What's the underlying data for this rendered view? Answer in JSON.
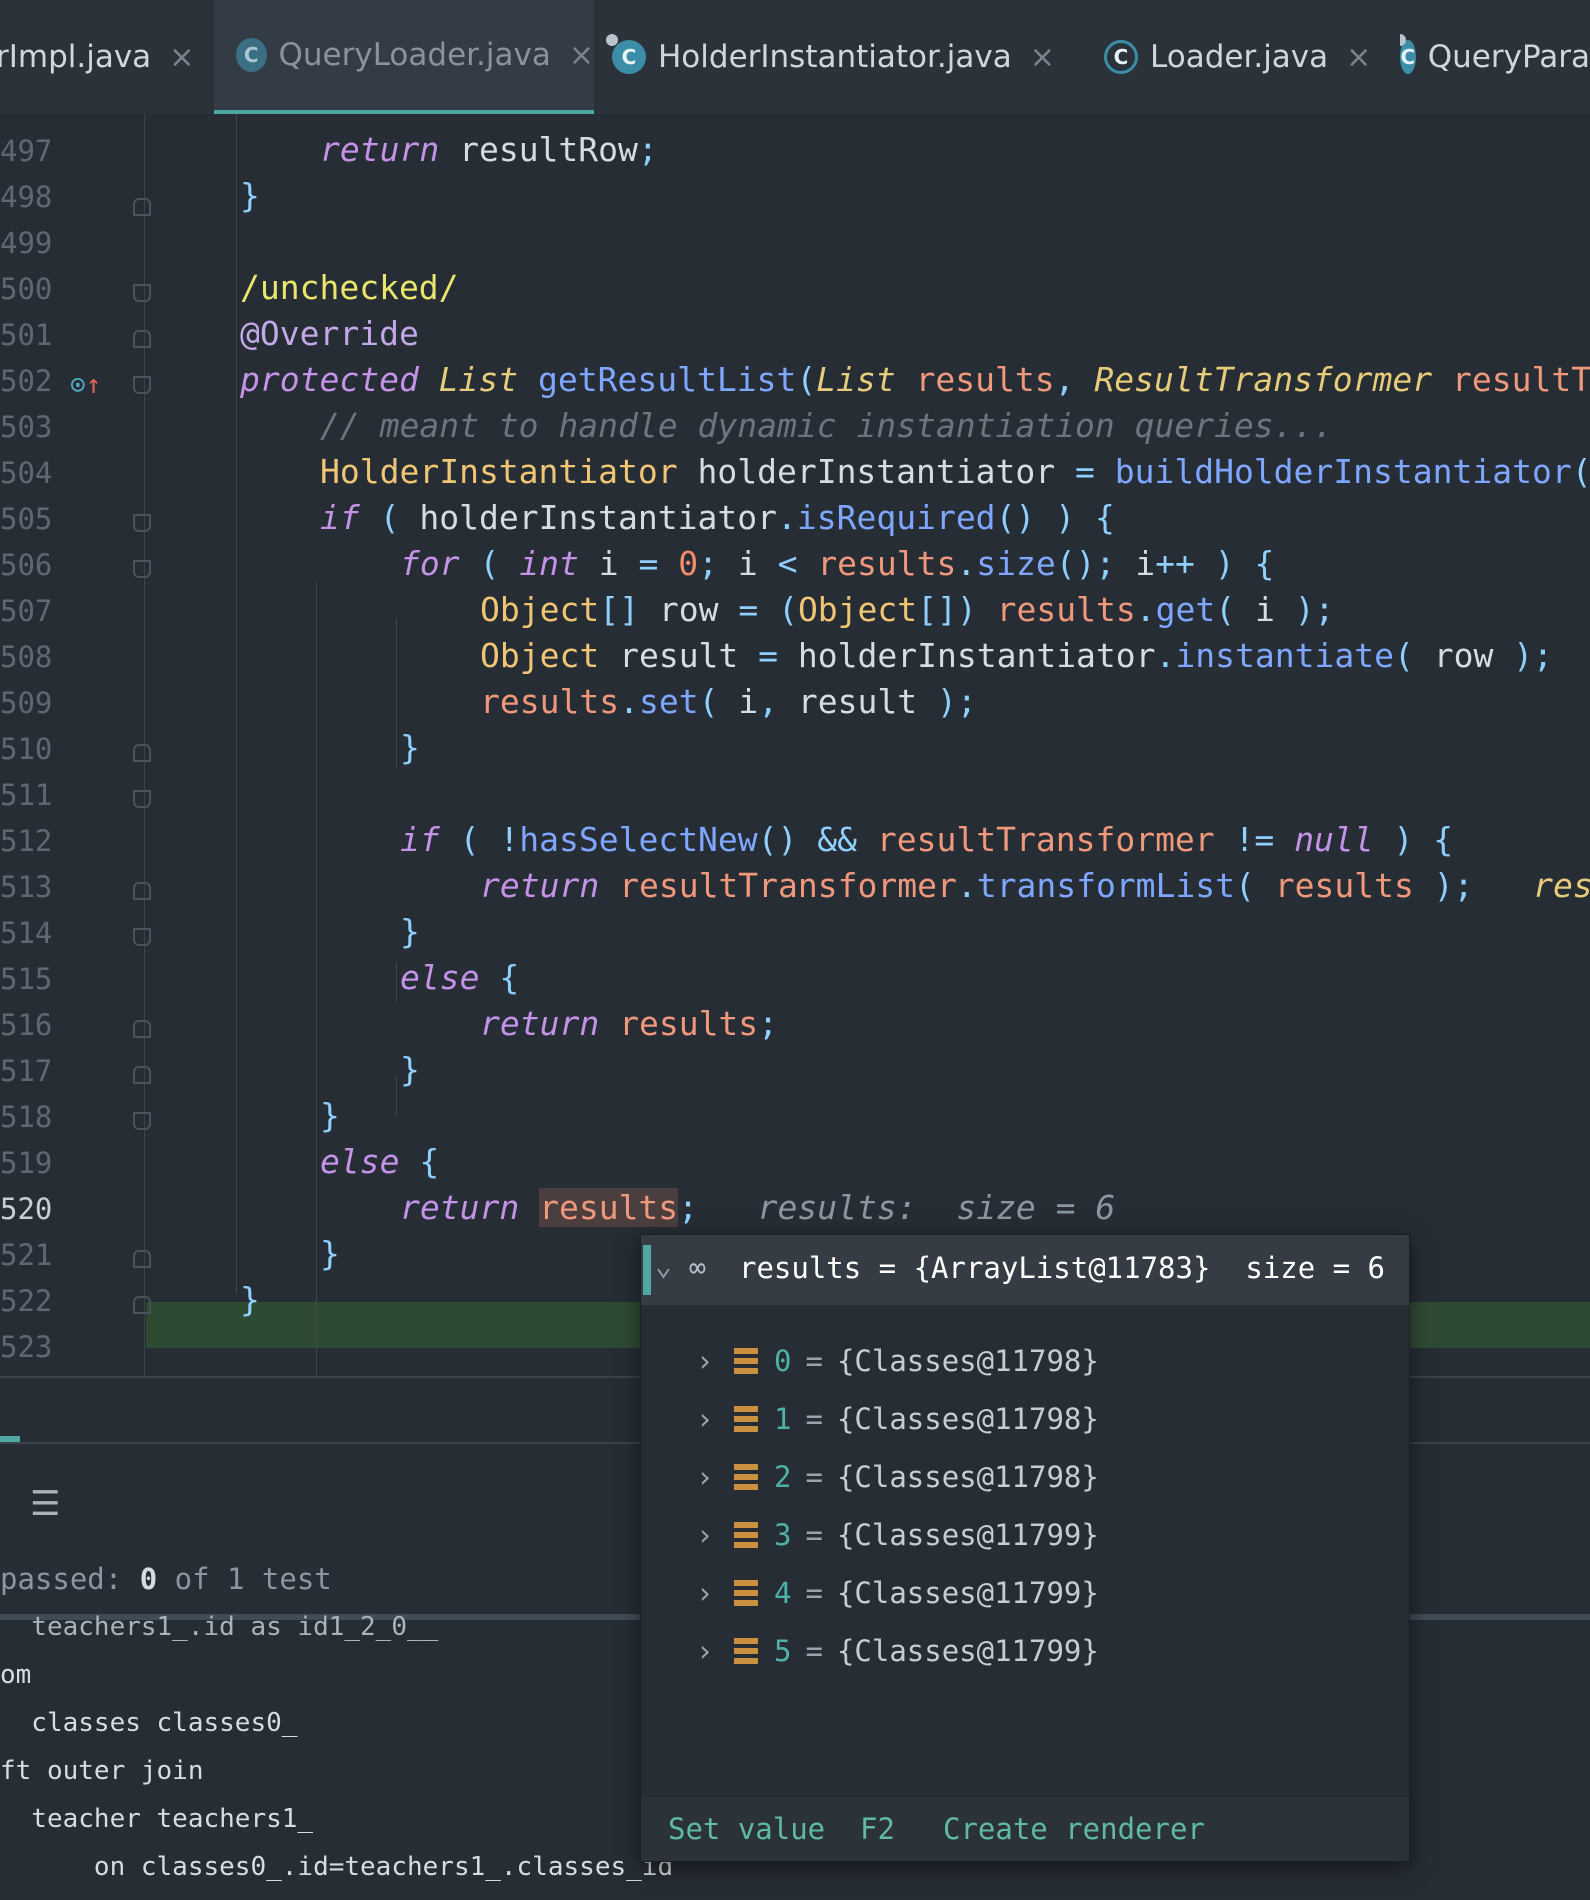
{
  "tabs": [
    {
      "label": "rImpl.java",
      "active": false
    },
    {
      "label": "QueryLoader.java",
      "active": true
    },
    {
      "label": "HolderInstantiator.java",
      "active": false
    },
    {
      "label": "Loader.java",
      "active": false
    },
    {
      "label": "QueryPara",
      "active": false
    }
  ],
  "tab_close_glyph": "×",
  "editor": {
    "line_numbers": [
      "497",
      "498",
      "499",
      "500",
      "501",
      "502",
      "503",
      "504",
      "505",
      "506",
      "507",
      "508",
      "509",
      "510",
      "511",
      "512",
      "513",
      "514",
      "515",
      "516",
      "517",
      "518",
      "519",
      "520",
      "521",
      "522",
      "523"
    ],
    "current_line": "520",
    "inline_hint": "results:  size = 6"
  },
  "debug_popup": {
    "header_label": "results = {ArrayList@11783}  size = 6",
    "items": [
      {
        "index": "0",
        "value": "{Classes@11798}"
      },
      {
        "index": "1",
        "value": "{Classes@11798}"
      },
      {
        "index": "2",
        "value": "{Classes@11798}"
      },
      {
        "index": "3",
        "value": "{Classes@11799}"
      },
      {
        "index": "4",
        "value": "{Classes@11799}"
      },
      {
        "index": "5",
        "value": "{Classes@11799}"
      }
    ],
    "set_value_label": "Set value  F2",
    "create_renderer_label": "Create renderer"
  },
  "test_panel": {
    "passed_prefix": "passed: ",
    "passed_count": "0",
    "passed_suffix": " of 1 test",
    "console_lines": [
      "  teachers1_.id as id1_2_0__",
      "om",
      "  classes classes0_",
      "ft outer join",
      "  teacher teachers1_",
      "      on classes0_.id=teachers1_.classes_id"
    ]
  },
  "colors": {
    "accent": "#4fa8a3",
    "current_line_bg": "#2f4a33",
    "keyword": "#c492e6"
  }
}
